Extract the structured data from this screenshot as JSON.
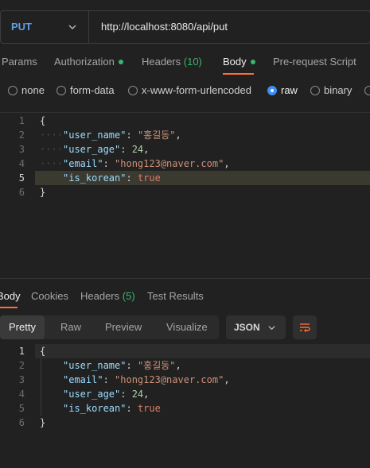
{
  "request": {
    "method": "PUT",
    "url": "http://localhost:8080/api/put"
  },
  "request_tabs": [
    {
      "label": "Params"
    },
    {
      "label": "Authorization"
    },
    {
      "label": "Headers",
      "count": "(10)"
    },
    {
      "label": "Body"
    },
    {
      "label": "Pre-request Script"
    }
  ],
  "body_types": [
    {
      "label": "none",
      "selected": false
    },
    {
      "label": "form-data",
      "selected": false
    },
    {
      "label": "x-www-form-urlencoded",
      "selected": false
    },
    {
      "label": "raw",
      "selected": true
    },
    {
      "label": "binary",
      "selected": false
    }
  ],
  "request_body": {
    "line_numbers": [
      "1",
      "2",
      "3",
      "4",
      "5",
      "6"
    ],
    "lines": [
      "{",
      "\"user_name\": \"홍길동\",",
      "\"user_age\": 24,",
      "\"email\": \"hong123@naver.com\",",
      "\"is_korean\": true",
      "}"
    ],
    "current_line": "5"
  },
  "response_tabs": [
    {
      "label": "Body"
    },
    {
      "label": "Cookies"
    },
    {
      "label": "Headers",
      "count": "(5)"
    },
    {
      "label": "Test Results"
    }
  ],
  "response_views": [
    "Pretty",
    "Raw",
    "Preview",
    "Visualize"
  ],
  "response_format": "JSON",
  "response_body": {
    "line_numbers": [
      "1",
      "2",
      "3",
      "4",
      "5",
      "6"
    ],
    "lines": [
      "{",
      "\"user_name\": \"홍길동\",",
      "\"email\": \"hong123@naver.com\",",
      "\"user_age\": 24,",
      "\"is_korean\": true",
      "}"
    ]
  },
  "colors": {
    "accent": "#ff6c37",
    "method": "#5f9fe6",
    "status_dot": "#3ab56e"
  }
}
